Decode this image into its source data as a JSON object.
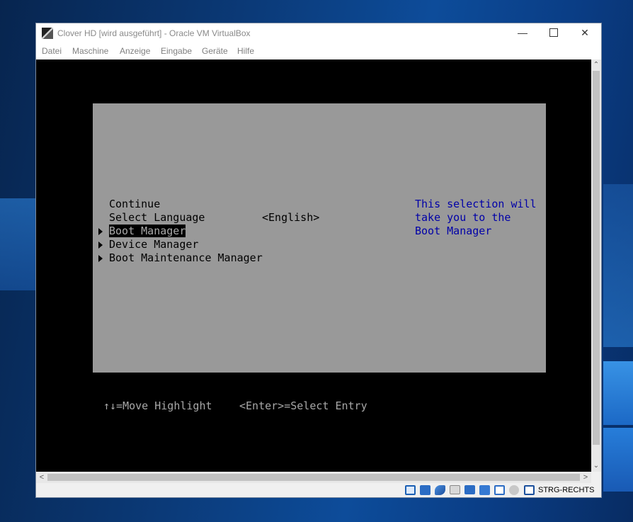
{
  "window": {
    "title": "Clover HD [wird ausgeführt] - Oracle VM VirtualBox",
    "minimize_glyph": "—",
    "close_glyph": "✕"
  },
  "menubar": {
    "items": [
      "Datei",
      "Maschine",
      "Anzeige",
      "Eingabe",
      "Geräte",
      "Hilfe"
    ]
  },
  "bios": {
    "menu": [
      {
        "label": "Continue",
        "has_submenu": false,
        "selected": false
      },
      {
        "label": "Select Language",
        "has_submenu": false,
        "selected": false
      },
      {
        "label": "Boot Manager",
        "has_submenu": true,
        "selected": true
      },
      {
        "label": "Device Manager",
        "has_submenu": true,
        "selected": false
      },
      {
        "label": "Boot Maintenance Manager",
        "has_submenu": true,
        "selected": false
      }
    ],
    "language_value": "<English>",
    "help_text": "This selection will take you to the Boot Manager",
    "hint_move": "↑↓=Move Highlight",
    "hint_select": "<Enter>=Select Entry",
    "colors": {
      "panel": "#999999",
      "help": "#0000a8",
      "highlight_bg": "#000000",
      "screen": "#000000"
    }
  },
  "scrollbars": {
    "up_glyph": "⌃",
    "down_glyph": "⌄",
    "left_glyph": "<",
    "right_glyph": ">"
  },
  "statusbar": {
    "icons": [
      "hard-disk-icon",
      "optical-drive-icon",
      "usb-icon",
      "shared-folder-icon",
      "display-icon",
      "network-icon",
      "video-capture-icon",
      "mouse-integration-icon",
      "keyboard-capture-icon"
    ],
    "host_key": "STRG-RECHTS"
  }
}
